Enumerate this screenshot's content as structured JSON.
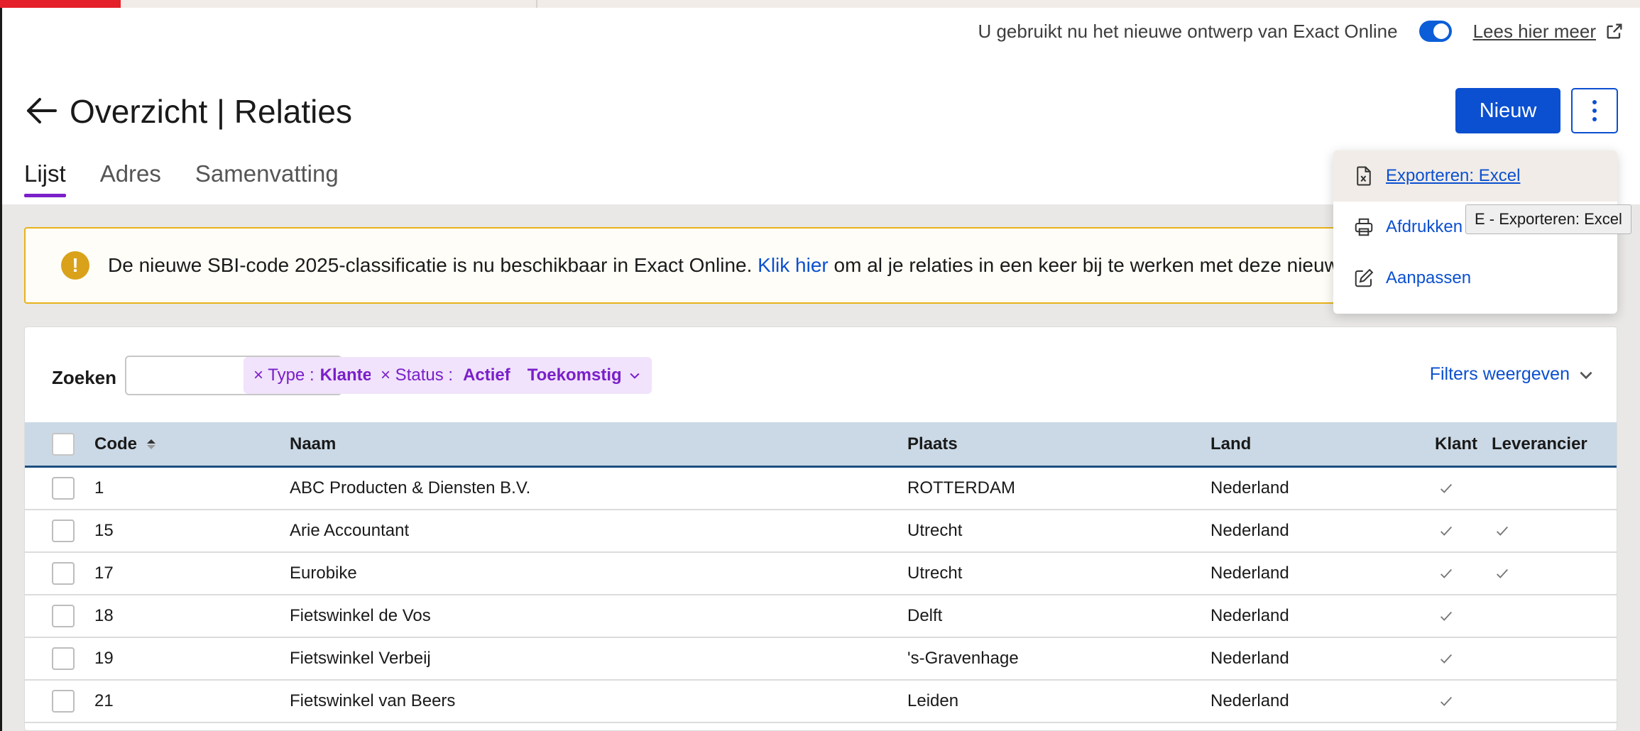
{
  "progress": {
    "fraction": 0.05,
    "color": "#e4202a"
  },
  "design_notice": {
    "text": "U gebruikt nu het nieuwe ontwerp van Exact Online",
    "toggle_on": true,
    "read_more": "Lees hier meer"
  },
  "header": {
    "title": "Overzicht | Relaties",
    "new_button": "Nieuw"
  },
  "tabs": [
    {
      "label": "Lijst",
      "active": true
    },
    {
      "label": "Adres",
      "active": false
    },
    {
      "label": "Samenvatting",
      "active": false
    }
  ],
  "banner": {
    "text_before": "De nieuwe SBI-code 2025-classificatie is nu beschikbaar in Exact Online.",
    "link": "Klik hier",
    "text_after": "om al je relaties in een keer bij te werken met deze nieuw"
  },
  "filters": {
    "search_label": "Zoeken",
    "search_value": "",
    "chip_type": {
      "prefix": "× Type :",
      "value": "Klanten"
    },
    "chip_status": {
      "prefix": "× Status :",
      "value1": "Actief",
      "value2": "Toekomstig"
    },
    "show_filters": "Filters weergeven"
  },
  "table": {
    "columns": [
      "Code",
      "Naam",
      "Plaats",
      "Land",
      "Klant",
      "Leverancier"
    ],
    "rows": [
      {
        "code": "1",
        "naam": "ABC Producten & Diensten B.V.",
        "plaats": "ROTTERDAM",
        "land": "Nederland",
        "klant": true,
        "leverancier": false
      },
      {
        "code": "15",
        "naam": "Arie Accountant",
        "plaats": "Utrecht",
        "land": "Nederland",
        "klant": true,
        "leverancier": true
      },
      {
        "code": "17",
        "naam": "Eurobike",
        "plaats": "Utrecht",
        "land": "Nederland",
        "klant": true,
        "leverancier": true
      },
      {
        "code": "18",
        "naam": "Fietswinkel de Vos",
        "plaats": "Delft",
        "land": "Nederland",
        "klant": true,
        "leverancier": false
      },
      {
        "code": "19",
        "naam": "Fietswinkel Verbeij",
        "plaats": "'s-Gravenhage",
        "land": "Nederland",
        "klant": true,
        "leverancier": false
      },
      {
        "code": "21",
        "naam": "Fietswinkel van Beers",
        "plaats": "Leiden",
        "land": "Nederland",
        "klant": true,
        "leverancier": false
      }
    ]
  },
  "menu": {
    "items": [
      {
        "label": "Exporteren: Excel",
        "icon": "excel-file-icon"
      },
      {
        "label": "Afdrukken",
        "icon": "printer-icon"
      },
      {
        "label": "Aanpassen",
        "icon": "edit-icon"
      }
    ],
    "tooltip": "E - Exporteren: Excel"
  },
  "colors": {
    "primary": "#0b50d0",
    "accent": "#7a1fc9",
    "warning": "#d9a21a",
    "header_row": "#cbd9e6"
  }
}
